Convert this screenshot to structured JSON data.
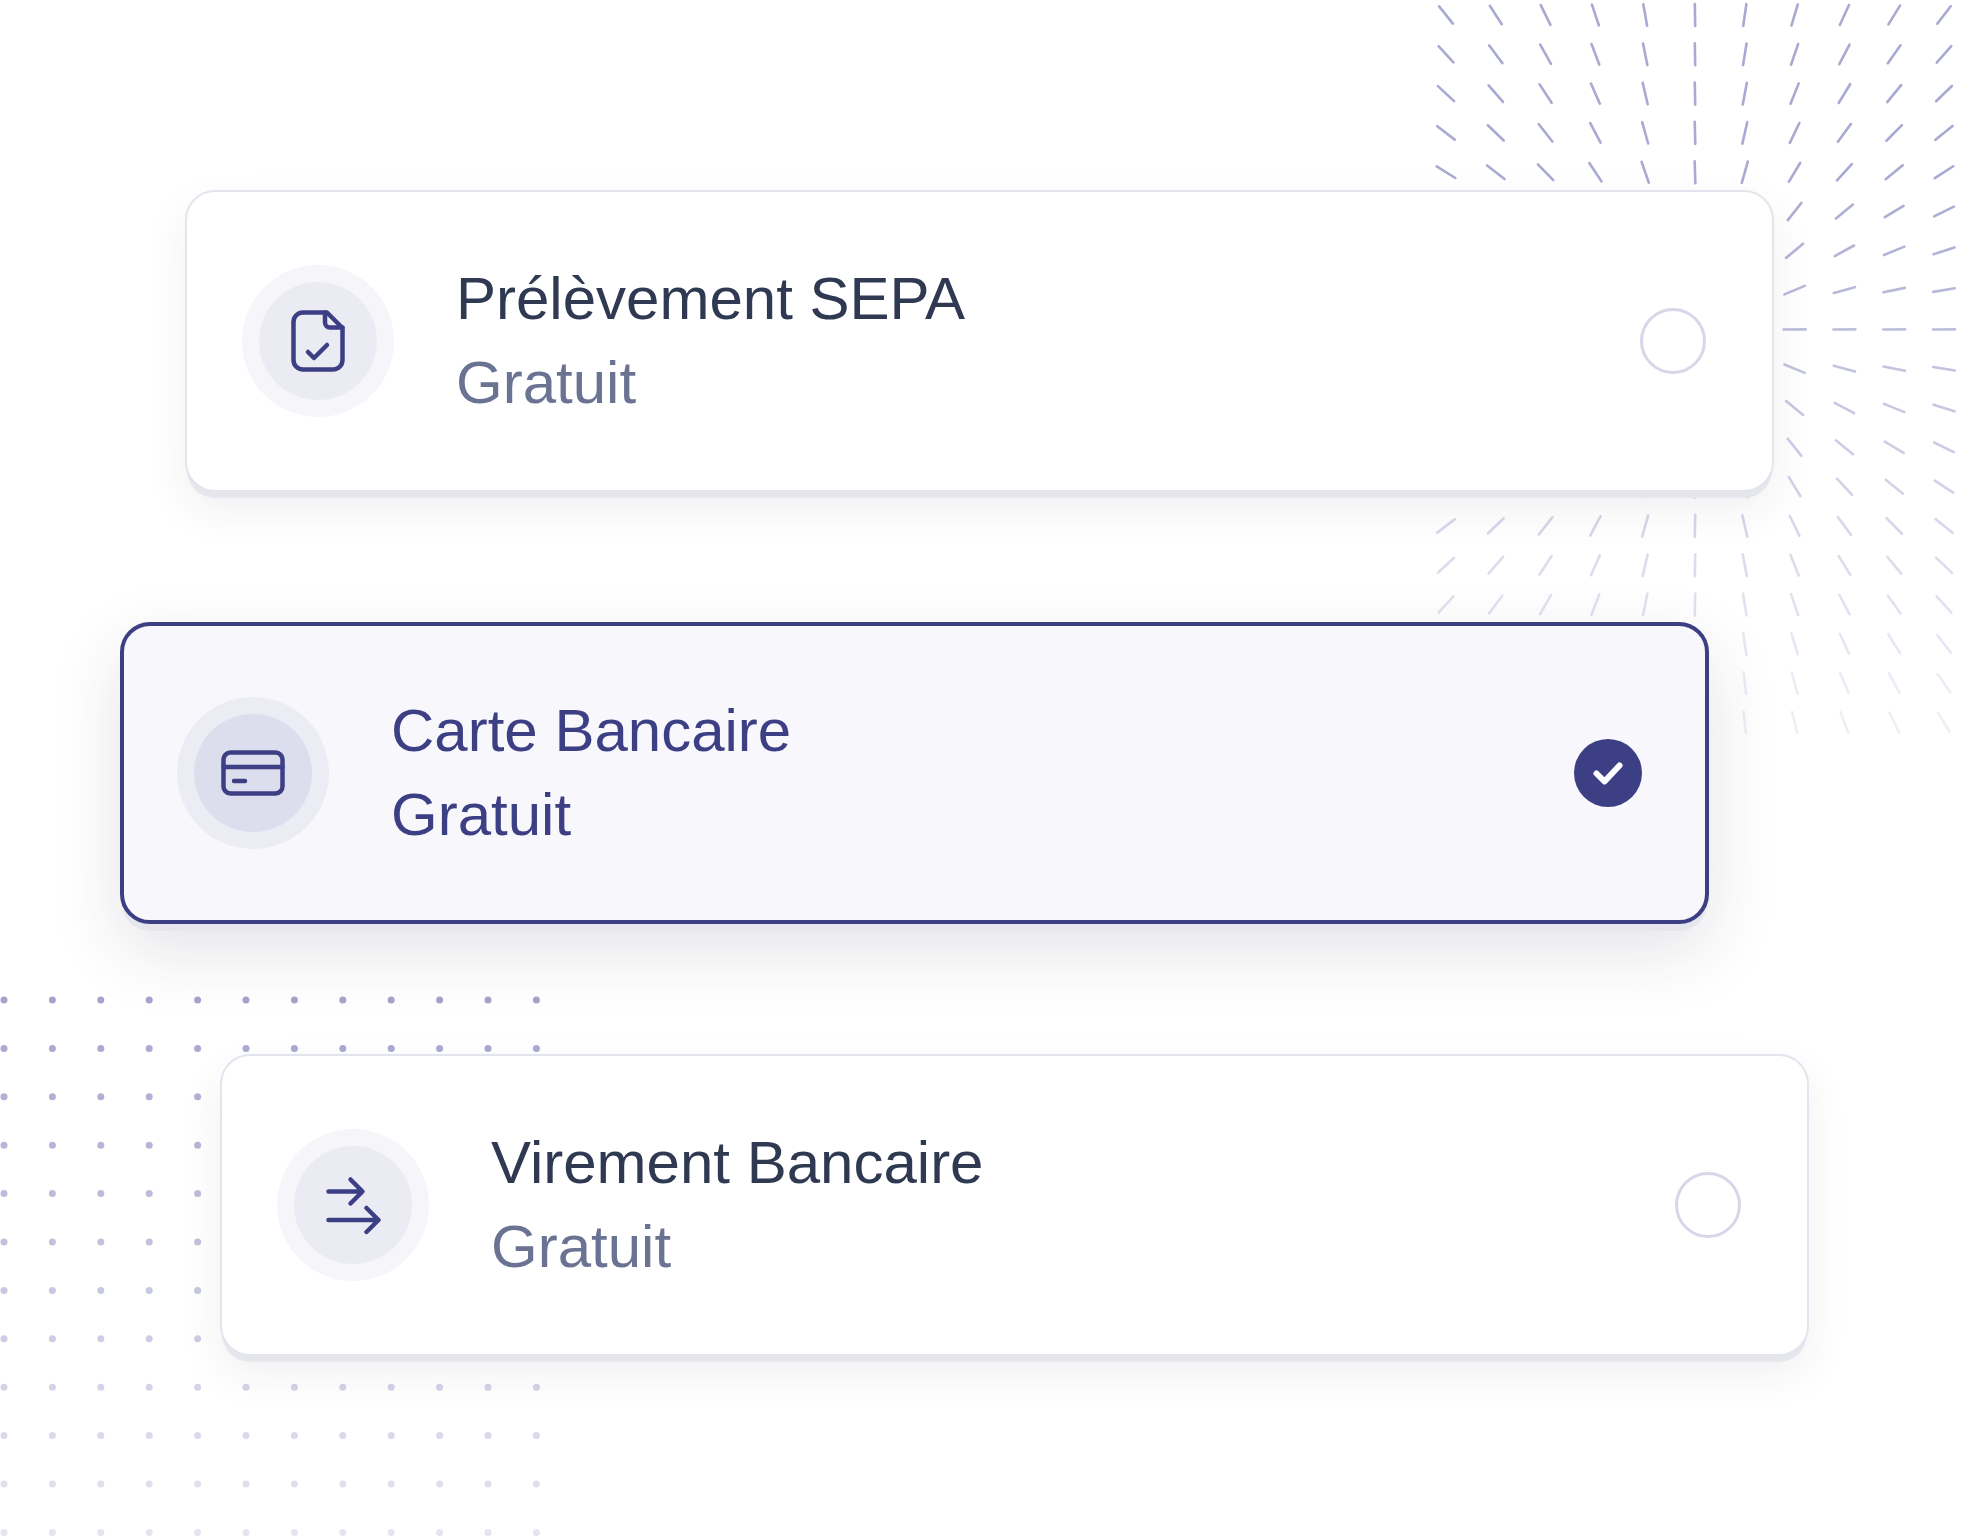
{
  "payment_methods": [
    {
      "kind": "sepa",
      "title": "Prélèvement SEPA",
      "price": "Gratuit",
      "selected": false
    },
    {
      "kind": "card",
      "title": "Carte Bancaire",
      "price": "Gratuit",
      "selected": true
    },
    {
      "kind": "transfer",
      "title": "Virement Bancaire",
      "price": "Gratuit",
      "selected": false
    }
  ]
}
